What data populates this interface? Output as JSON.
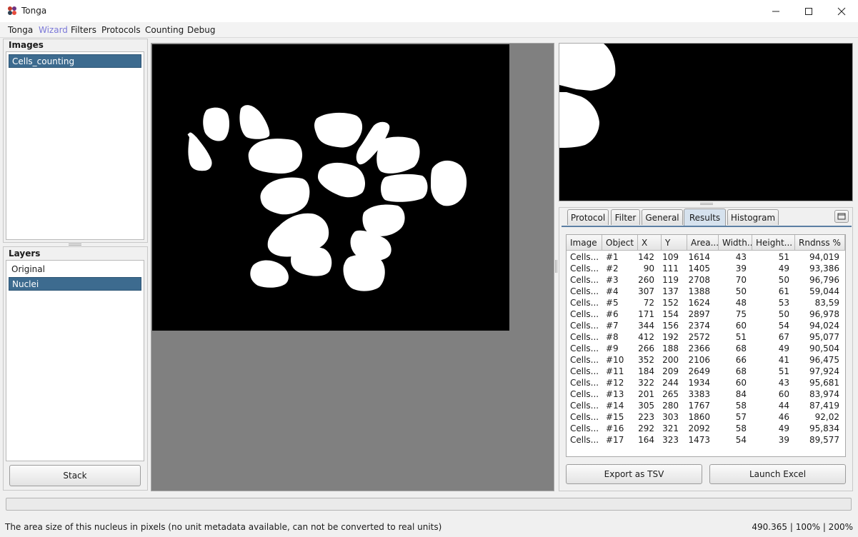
{
  "window": {
    "title": "Tonga"
  },
  "menu": [
    "Tonga",
    "Wizard",
    "Filters",
    "Protocols",
    "Counting",
    "Debug"
  ],
  "images_panel": {
    "title": "Images",
    "items": [
      "Cells_counting"
    ],
    "selected": 0
  },
  "layers_panel": {
    "title": "Layers",
    "items": [
      "Original",
      "Nuclei"
    ],
    "selected": 1
  },
  "stack_button": "Stack",
  "tabs": [
    "Protocol",
    "Filter",
    "General",
    "Results",
    "Histogram"
  ],
  "active_tab": "Results",
  "results_table": {
    "columns": [
      "Image",
      "Object",
      "X",
      "Y",
      "Area...",
      "Width...",
      "Height...",
      "Rndnss %"
    ],
    "rows": [
      [
        "Cells...",
        "#1",
        "142",
        "109",
        "1614",
        "43",
        "51",
        "94,019"
      ],
      [
        "Cells...",
        "#2",
        "90",
        "111",
        "1405",
        "39",
        "49",
        "93,386"
      ],
      [
        "Cells...",
        "#3",
        "260",
        "119",
        "2708",
        "70",
        "50",
        "96,796"
      ],
      [
        "Cells...",
        "#4",
        "307",
        "137",
        "1388",
        "50",
        "61",
        "59,044"
      ],
      [
        "Cells...",
        "#5",
        "72",
        "152",
        "1624",
        "48",
        "53",
        "83,59"
      ],
      [
        "Cells...",
        "#6",
        "171",
        "154",
        "2897",
        "75",
        "50",
        "96,978"
      ],
      [
        "Cells...",
        "#7",
        "344",
        "156",
        "2374",
        "60",
        "54",
        "94,024"
      ],
      [
        "Cells...",
        "#8",
        "412",
        "192",
        "2572",
        "51",
        "67",
        "95,077"
      ],
      [
        "Cells...",
        "#9",
        "266",
        "188",
        "2366",
        "68",
        "49",
        "90,504"
      ],
      [
        "Cells...",
        "#10",
        "352",
        "200",
        "2106",
        "66",
        "41",
        "96,475"
      ],
      [
        "Cells...",
        "#11",
        "184",
        "209",
        "2649",
        "68",
        "51",
        "97,924"
      ],
      [
        "Cells...",
        "#12",
        "322",
        "244",
        "1934",
        "60",
        "43",
        "95,681"
      ],
      [
        "Cells...",
        "#13",
        "201",
        "265",
        "3383",
        "84",
        "60",
        "83,974"
      ],
      [
        "Cells...",
        "#14",
        "305",
        "280",
        "1767",
        "58",
        "44",
        "87,419"
      ],
      [
        "Cells...",
        "#15",
        "223",
        "303",
        "1860",
        "57",
        "46",
        "92,02"
      ],
      [
        "Cells...",
        "#16",
        "292",
        "321",
        "2092",
        "58",
        "49",
        "95,834"
      ],
      [
        "Cells...",
        "#17",
        "164",
        "323",
        "1473",
        "54",
        "39",
        "89,577"
      ]
    ]
  },
  "buttons": {
    "export": "Export as TSV",
    "excel": "Launch Excel"
  },
  "status": {
    "message": "The area size of this nucleus in pixels (no unit metadata available, can not be converted to real units)",
    "info": "490.365 | 100% | 200%"
  },
  "colors": {
    "selection": "#3d6b8f",
    "wizard_menu": "#7b78d8",
    "canvas_bg": "#808080"
  }
}
